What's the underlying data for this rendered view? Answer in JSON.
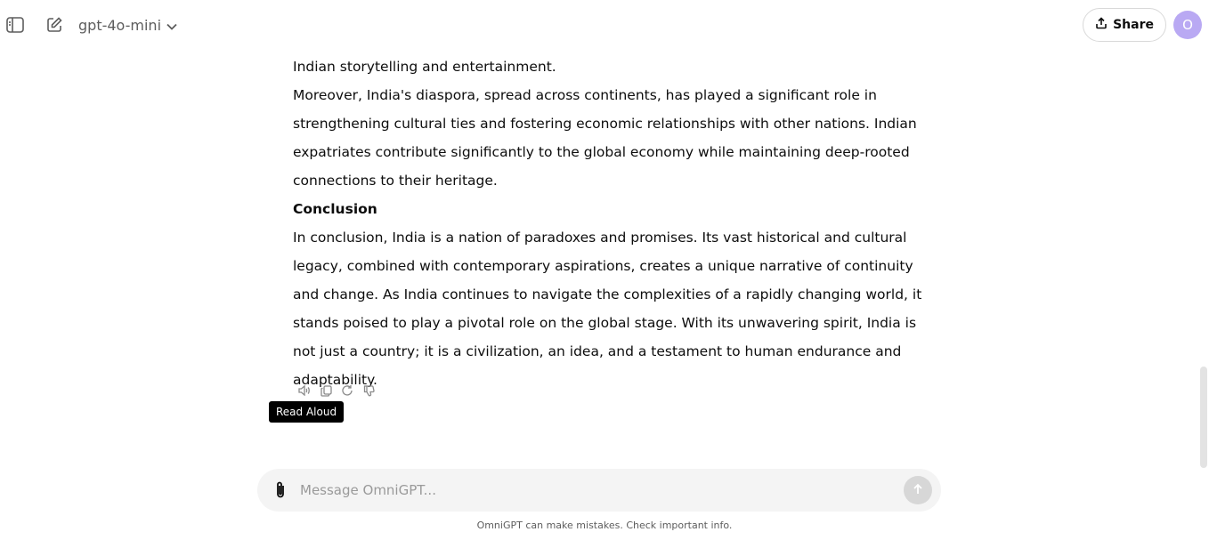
{
  "header": {
    "model_label": "gpt-4o-mini",
    "share_label": "Share",
    "avatar_initial": "O"
  },
  "message": {
    "paragraphs": [
      "Indian storytelling and entertainment.",
      "Moreover, India's diaspora, spread across continents, has played a significant role in strengthening cultural ties and fostering economic relationships with other nations. Indian expatriates contribute significantly to the global economy while maintaining deep-rooted connections to their heritage.",
      "Conclusion",
      "In conclusion, India is a nation of paradoxes and promises. Its vast historical and cultural legacy, combined with contemporary aspirations, creates a unique narrative of continuity and change. As India continues to navigate the complexities of a rapidly changing world, it stands poised to play a pivotal role on the global stage. With its unwavering spirit, India is not just a country; it is a civilization, an idea, and a testament to human endurance and adaptability."
    ]
  },
  "actions": {
    "tooltip": "Read Aloud",
    "icons": [
      "speaker-icon",
      "copy-icon",
      "regenerate-icon",
      "thumbs-down-icon"
    ]
  },
  "composer": {
    "placeholder": "Message OmniGPT..."
  },
  "footer": {
    "disclaimer": "OmniGPT can make mistakes. Check important info."
  },
  "colors": {
    "avatar_bg": "#b9a9f3",
    "tooltip_bg": "#000000",
    "composer_bg": "#f4f4f4"
  }
}
